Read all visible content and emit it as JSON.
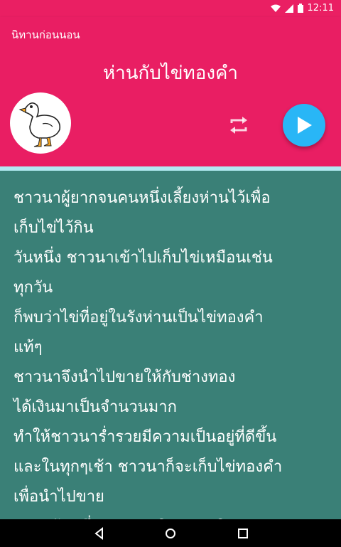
{
  "status_bar": {
    "time": "12:11",
    "icons": [
      "wifi-icon",
      "signal-icon",
      "battery-icon"
    ]
  },
  "app_bar": {
    "title": "นิทานก่อนนอน"
  },
  "story": {
    "title": "ห่านกับไข่ทองคำ",
    "lines": [
      "ชาวนาผู้ยากจนคนหนึ่งเลี้ยงห่านไว้เพื่อ",
      "เก็บไข่ไว้กิน",
      "วันหนึ่ง ชาวนาเข้าไปเก็บไข่เหมือนเช่น",
      "ทุกวัน",
      "ก็พบว่าไข่ที่อยู่ในรังห่านเป็นไข่ทองคำ",
      "แท้ๆ",
      "ชาวนาจึงนำไปขายให้กับช่างทอง",
      "ได้เงินมาเป็นจำนวนมาก",
      "ทำให้ชาวนาร่ำรวยมีความเป็นอยู่ที่ดีขึ้น",
      "และในทุกๆเช้า ชาวนาก็จะเก็บไข่ทองคำ",
      "เพื่อนำไปขาย",
      "อยู่มาวันหนึ่ง ชาวนาเกิดความคิดว่า"
    ]
  },
  "controls": {
    "repeat_icon": "repeat-icon",
    "play_icon": "play-icon"
  },
  "colors": {
    "primary": "#e91e63",
    "play_button": "#29b6f6",
    "story_background": "#3a8077",
    "story_border": "#b2ebf2"
  }
}
